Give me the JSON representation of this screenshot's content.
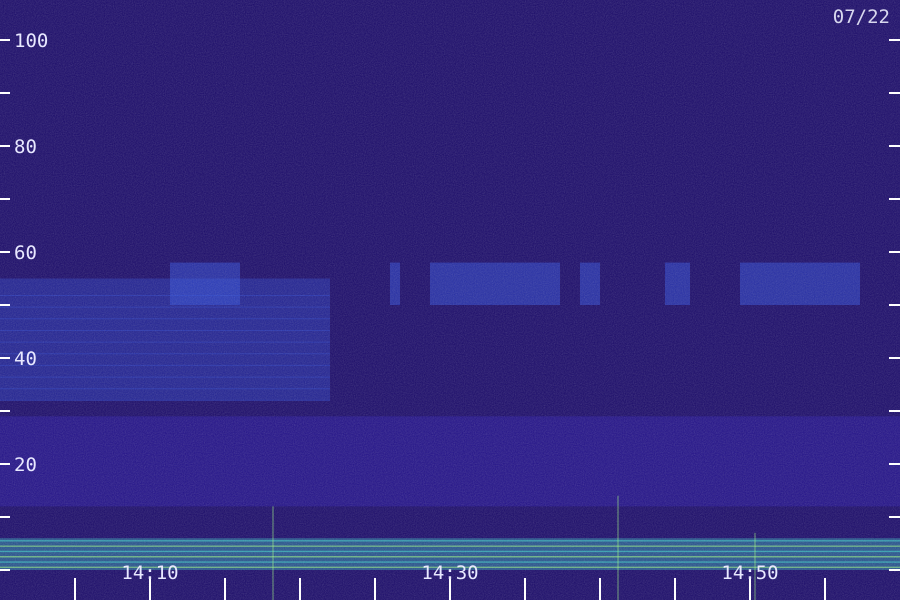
{
  "chart_data": {
    "type": "heatmap",
    "title": "",
    "xlabel": "",
    "ylabel": "",
    "date_label": "07/22",
    "ylim": [
      0,
      102
    ],
    "y_tick_labels": [
      {
        "value": 20,
        "label": "20"
      },
      {
        "value": 40,
        "label": "40"
      },
      {
        "value": 60,
        "label": "60"
      },
      {
        "value": 80,
        "label": "80"
      },
      {
        "value": 100,
        "label": "100"
      }
    ],
    "y_ticks": [
      0,
      10,
      20,
      30,
      40,
      50,
      60,
      70,
      80,
      90,
      100
    ],
    "x_tick_labels": [
      {
        "time": "14:10",
        "label": "14:10"
      },
      {
        "time": "14:30",
        "label": "14:30"
      },
      {
        "time": "14:50",
        "label": "14:50"
      }
    ],
    "x_ticks": [
      "14:05",
      "14:10",
      "14:15",
      "14:20",
      "14:25",
      "14:30",
      "14:35",
      "14:40",
      "14:45",
      "14:50",
      "14:55"
    ],
    "bands": [
      {
        "from": 0,
        "to": 6,
        "intensity": "high"
      },
      {
        "from": 12,
        "to": 29,
        "intensity": "medium"
      },
      {
        "from": 50,
        "to": 58,
        "intensity": "intermittent bursts"
      }
    ],
    "colors": {
      "background": "#1a0a6a",
      "low": "#2a18a8",
      "medium": "#3050e0",
      "high": "#40e0d0",
      "peak": "#a0ff80"
    }
  }
}
